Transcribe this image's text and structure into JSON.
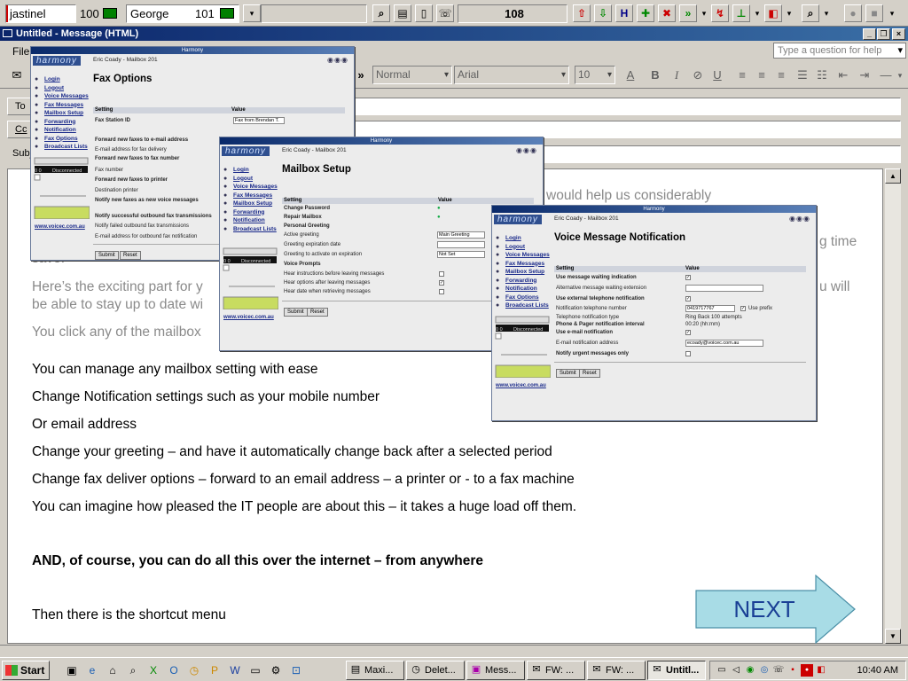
{
  "toolbar": {
    "user1": "jastinel",
    "user1_count": "100",
    "user2": "George",
    "user2_count": "101",
    "counter": "108"
  },
  "window": {
    "title": "Untitled - Message (HTML)",
    "min": "_",
    "restore": "❐",
    "close": "×"
  },
  "menu": {
    "file": "File",
    "help_placeholder": "Type a question for help"
  },
  "format": {
    "style": "Normal",
    "font": "Arial",
    "size": "10",
    "bold": "B",
    "italic": "I",
    "underline": "U"
  },
  "headers": {
    "to": "To",
    "cc": "Cc",
    "subject": "Subje"
  },
  "body": {
    "grey1": "would help us considerably",
    "grey2a": "g time",
    "grey2b": "save.",
    "grey3a": "Here’s the exciting part for y",
    "grey3b": "u will",
    "grey4": "be able to stay up to date wi",
    "grey5": "You click any of the mailbox",
    "l1": "You can manage any mailbox setting with ease",
    "l2": "Change Notification settings such as your mobile number",
    "l3": "Or email address",
    "l4": "Change your greeting – and have it automatically change back after a selected period",
    "l5": "Change fax deliver options – forward to an email address – a printer or - to a fax machine",
    "l6": "You can imagine how pleased the IT people are about this – it takes a huge load off them.",
    "l7": "AND, of course, you can do all this over the internet – from anywhere",
    "l8": "Then there is the shortcut menu",
    "next": "NEXT"
  },
  "harmony": {
    "app_title": "Harmony",
    "logo": "harmony",
    "user": "Eric Coady - Mailbox 201",
    "nav": [
      "Login",
      "Logout",
      "Voice Messages",
      "Fax Messages",
      "Mailbox Setup",
      "Forwarding",
      "Notification",
      "Fax Options",
      "Broadcast Lists"
    ],
    "status": "Disconnected",
    "lcd": "0 0",
    "link": "www.voicec.com.au",
    "col_setting": "Setting",
    "col_value": "Value",
    "submit": "Submit",
    "reset": "Reset",
    "fax": {
      "heading": "Fax Options",
      "rows": [
        {
          "label": "Fax Station ID",
          "bold": true,
          "value": "Fax from Brendan T."
        },
        {
          "label": "Forward new faxes to e-mail address",
          "bold": true,
          "value": ""
        },
        {
          "label": "E-mail address for fax delivery",
          "bold": false,
          "value": ""
        },
        {
          "label": "Forward new faxes to fax number",
          "bold": true,
          "value": ""
        },
        {
          "label": "Fax number",
          "bold": false,
          "value": ""
        },
        {
          "label": "Forward new faxes to printer",
          "bold": true,
          "value": ""
        },
        {
          "label": "Destination printer",
          "bold": false,
          "value": ""
        },
        {
          "label": "Notify new faxes as new voice messages",
          "bold": true,
          "value": ""
        },
        {
          "label": "Notify successful outbound fax transmissions",
          "bold": true,
          "value": ""
        },
        {
          "label": "Notify failed outbound fax transmissions",
          "bold": false,
          "value": ""
        },
        {
          "label": "E-mail address for outbound fax notification",
          "bold": false,
          "value": ""
        }
      ]
    },
    "mailbox": {
      "heading": "Mailbox Setup",
      "rows": [
        {
          "label": "Change Password",
          "bold": true
        },
        {
          "label": "Repair Mailbox",
          "bold": true
        },
        {
          "label": "Personal Greeting",
          "bold": true
        },
        {
          "label": "Active greeting",
          "bold": false,
          "value": "Main Greeting"
        },
        {
          "label": "Greeting expiration date",
          "bold": false
        },
        {
          "label": "Greeting to activate on expiration",
          "bold": false,
          "value": "Not Set"
        },
        {
          "label": "Voice Prompts",
          "bold": true
        },
        {
          "label": "Hear instructions before leaving messages",
          "bold": false
        },
        {
          "label": "Hear options after leaving messages",
          "bold": false,
          "value": "✓"
        },
        {
          "label": "Hear date when retrieving messages",
          "bold": false
        }
      ]
    },
    "voice": {
      "heading": "Voice Message Notification",
      "rows": [
        {
          "label": "Use message waiting indication",
          "bold": true,
          "value": "✓"
        },
        {
          "label": "Alternative message waiting extension",
          "bold": false
        },
        {
          "label": "Use external telephone notification",
          "bold": true,
          "value": "✓"
        },
        {
          "label": "Notification telephone number",
          "bold": false,
          "value": "0419717767",
          "extra": "Use prefix"
        },
        {
          "label": "Telephone notification type",
          "bold": false,
          "value": "Ring Back 100 attempts"
        },
        {
          "label": "Phone & Pager notification interval",
          "bold": true,
          "value": "00:20 (hh:mm)"
        },
        {
          "label": "Use e-mail notification",
          "bold": true,
          "value": "✓"
        },
        {
          "label": "E-mail notification address",
          "bold": false,
          "value": "ecoady@voicec.com.au"
        },
        {
          "label": "Notify urgent messages only",
          "bold": true
        }
      ]
    }
  },
  "taskbar": {
    "start": "Start",
    "tasks": [
      "Maxi...",
      "Delet...",
      "Mess...",
      "FW: ...",
      "FW: ...",
      "Untitl..."
    ],
    "clock": "10:40 AM"
  },
  "colors": {
    "titlebar": "#0a246a",
    "next_arrow_fill": "#a8dce6",
    "next_text": "#1a3f95"
  }
}
